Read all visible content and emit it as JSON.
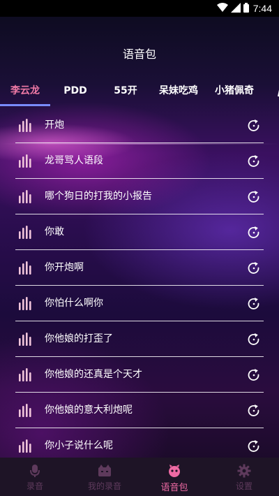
{
  "status_bar": {
    "time": "7:44"
  },
  "header": {
    "title": "语音包"
  },
  "tabs": [
    {
      "label": "李云龙",
      "active": true
    },
    {
      "label": "PDD",
      "active": false
    },
    {
      "label": "55开",
      "active": false
    },
    {
      "label": "呆妹吃鸡",
      "active": false
    },
    {
      "label": "小猪佩奇",
      "active": false
    }
  ],
  "sounds": [
    {
      "label": "开炮"
    },
    {
      "label": "龙哥骂人语段"
    },
    {
      "label": "哪个狗日的打我的小报告"
    },
    {
      "label": "你敢"
    },
    {
      "label": "你开炮啊"
    },
    {
      "label": "你怕什么啊你"
    },
    {
      "label": "你他娘的打歪了"
    },
    {
      "label": "你他娘的还真是个天才"
    },
    {
      "label": "你他娘的意大利炮呢"
    },
    {
      "label": "你小子说什么呢"
    }
  ],
  "bottom_nav": [
    {
      "label": "录音",
      "icon": "microphone-icon",
      "active": false
    },
    {
      "label": "我的录音",
      "icon": "my-recordings-icon",
      "active": false
    },
    {
      "label": "语音包",
      "icon": "voice-pack-icon",
      "active": true
    },
    {
      "label": "设置",
      "icon": "gear-icon",
      "active": false
    }
  ],
  "colors": {
    "active_tab_text": "#f07aa6",
    "tab_indicator": "#7a8cff",
    "active_nav": "#ee6aa4",
    "inactive_nav": "#5e3a5c",
    "bars_icon": "#f0c4da"
  }
}
